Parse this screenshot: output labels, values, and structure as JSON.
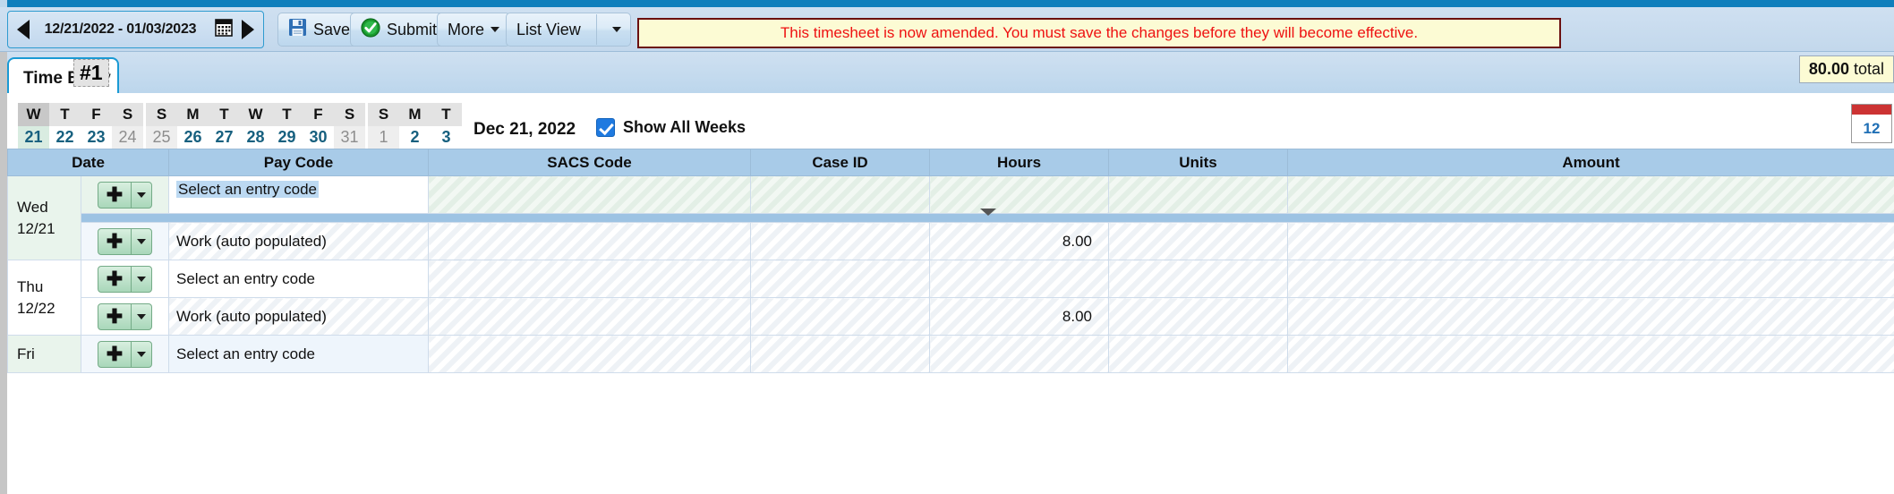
{
  "toolbar": {
    "date_range": "12/21/2022 - 01/03/2023",
    "prev_icon": "triangle-left-icon",
    "next_icon": "triangle-right-icon",
    "calendar_icon": "calendar-icon",
    "save_label": "Save",
    "save_icon": "floppy-disk-icon",
    "submit_label": "Submit",
    "submit_icon": "green-check-circle-icon",
    "more_label": "More",
    "list_view_label": "List View",
    "message": "This timesheet is now amended. You must save the changes before they will become effective.",
    "message_color": "#ee1111",
    "message_bg": "#fcfbd4",
    "message_border": "#6b1010"
  },
  "tabs": {
    "time_entry_label": "Time Entry",
    "badge": "#1",
    "total": "80.00",
    "total_suffix": " total"
  },
  "weeks": {
    "today_label": "Dec 21, 2022",
    "show_all_weeks_label": "Show All Weeks",
    "show_all_weeks_checked": true,
    "mini_calendar_icon": "calendar-icon",
    "mini_calendar_number": "12",
    "groups": [
      {
        "days": [
          {
            "dow": "W",
            "num": "21",
            "muted": false,
            "selected": true
          },
          {
            "dow": "T",
            "num": "22",
            "muted": false,
            "selected": false
          },
          {
            "dow": "F",
            "num": "23",
            "muted": false,
            "selected": false
          },
          {
            "dow": "S",
            "num": "24",
            "muted": true,
            "selected": false
          }
        ]
      },
      {
        "days": [
          {
            "dow": "S",
            "num": "25",
            "muted": true,
            "selected": false
          },
          {
            "dow": "M",
            "num": "26",
            "muted": false,
            "selected": false
          },
          {
            "dow": "T",
            "num": "27",
            "muted": false,
            "selected": false
          },
          {
            "dow": "W",
            "num": "28",
            "muted": false,
            "selected": false
          },
          {
            "dow": "T",
            "num": "29",
            "muted": false,
            "selected": false
          },
          {
            "dow": "F",
            "num": "30",
            "muted": false,
            "selected": false
          },
          {
            "dow": "S",
            "num": "31",
            "muted": true,
            "selected": false
          }
        ]
      },
      {
        "days": [
          {
            "dow": "S",
            "num": "1",
            "muted": true,
            "selected": false
          },
          {
            "dow": "M",
            "num": "2",
            "muted": false,
            "selected": false
          },
          {
            "dow": "T",
            "num": "3",
            "muted": false,
            "selected": false
          }
        ]
      }
    ]
  },
  "grid": {
    "columns": [
      "Date",
      "Pay Code",
      "SACS Code",
      "Case ID",
      "Hours",
      "Units",
      "Amount"
    ],
    "add_icon": "plus-icon",
    "dropdown_icon": "chevron-down-icon",
    "rows": [
      {
        "date": "Wed\n12/21",
        "date_line1": "Wed",
        "date_line2": "12/21",
        "entries": [
          {
            "pay_code": "Select an entry code",
            "selected": true,
            "hours": "",
            "units": "",
            "amount": ""
          },
          {
            "pay_code": "Work (auto populated)",
            "selected": false,
            "hours": "8.00",
            "units": "",
            "amount": ""
          }
        ]
      },
      {
        "date_line1": "Thu",
        "date_line2": "12/22",
        "entries": [
          {
            "pay_code": "Select an entry code",
            "selected": false,
            "hours": "",
            "units": "",
            "amount": ""
          },
          {
            "pay_code": "Work (auto populated)",
            "selected": false,
            "hours": "8.00",
            "units": "",
            "amount": ""
          }
        ]
      },
      {
        "date_line1": "Fri",
        "date_line2": "",
        "entries": [
          {
            "pay_code": "Select an entry code",
            "selected": false,
            "hours": "",
            "units": "",
            "amount": ""
          }
        ]
      }
    ]
  }
}
